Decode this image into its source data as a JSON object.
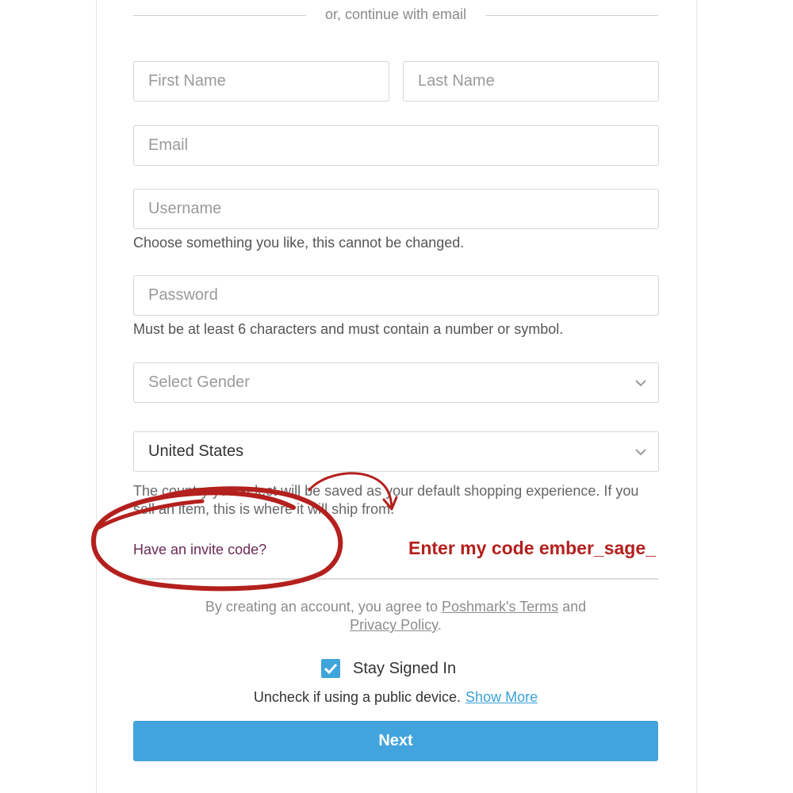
{
  "divider": {
    "text": "or, continue with email"
  },
  "form": {
    "first_name_placeholder": "First Name",
    "last_name_placeholder": "Last Name",
    "email_placeholder": "Email",
    "username_placeholder": "Username",
    "username_helper": "Choose something you like, this cannot be changed.",
    "password_placeholder": "Password",
    "password_helper": "Must be at least 6 characters and must contain a number or symbol.",
    "gender_placeholder": "Select Gender",
    "country_value": "United States",
    "country_helper": "The country you select will be saved as your default shopping experience. If you sell an item, this is where it will ship from.",
    "invite_link": "Have an invite code?"
  },
  "annotation": {
    "text": "Enter my code ember_sage_",
    "color": "#b3201d"
  },
  "terms": {
    "prefix": "By creating an account, you agree to ",
    "terms_link": "Poshmark's Terms",
    "middle": " and",
    "privacy_link": "Privacy Policy",
    "suffix": "."
  },
  "stay_signed_in": {
    "label": "Stay Signed In",
    "checked": true,
    "note": "Uncheck if using a public device.",
    "show_more": "Show More"
  },
  "next_button": {
    "label": "Next"
  },
  "colors": {
    "accent": "#43a3dc",
    "invite_link": "#6c2a55",
    "checkbox": "#3fa4dc"
  },
  "icons": [
    "chevron-down-icon",
    "check-icon"
  ]
}
